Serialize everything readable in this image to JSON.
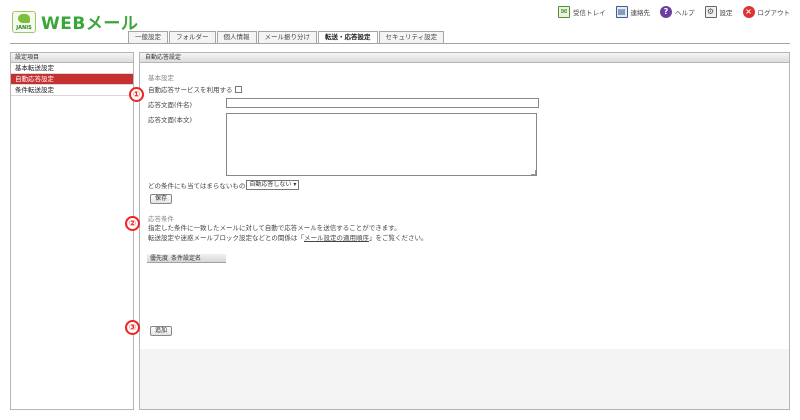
{
  "app": {
    "logo_badge_text": "JANIS",
    "title": "WEBメール"
  },
  "top_links": [
    {
      "label": "受信トレイ",
      "icon": "inbox-icon"
    },
    {
      "label": "連絡先",
      "icon": "address-book-icon"
    },
    {
      "label": "ヘルプ",
      "icon": "help-icon"
    },
    {
      "label": "設定",
      "icon": "settings-icon"
    },
    {
      "label": "ログアウト",
      "icon": "logout-icon"
    }
  ],
  "tabs": [
    {
      "label": "一般設定",
      "active": false
    },
    {
      "label": "フォルダー",
      "active": false
    },
    {
      "label": "個人情報",
      "active": false
    },
    {
      "label": "メール振り分け",
      "active": false
    },
    {
      "label": "転送・応答設定",
      "active": true
    },
    {
      "label": "セキュリティ設定",
      "active": false
    }
  ],
  "sidebar": {
    "header": "設定項目",
    "items": [
      {
        "label": "基本転送設定",
        "active": false
      },
      {
        "label": "自動応答設定",
        "active": true
      },
      {
        "label": "条件転送設定",
        "active": false
      }
    ]
  },
  "main": {
    "header": "自動応答設定",
    "basic": {
      "section_label": "基本設定",
      "enable_label": "自動応答サービスを利用する",
      "enable_checked": false,
      "subject_label": "応答文面(件名)",
      "subject_value": "",
      "body_label": "応答文面(本文)",
      "body_value": "",
      "fallback_label": "どの条件にも当てはまらないもの",
      "fallback_select": "自動応答しない",
      "save_label": "保存"
    },
    "conditions": {
      "section_label": "応答条件",
      "info_line1": "指定した条件に一致したメールに対して自動で応答メールを送信することができます。",
      "info_line2_prefix": "転送設定や迷惑メールブロック設定などとの関係は「",
      "info_link": "メール設定の適用順序",
      "info_line2_suffix": "」をご覧ください。",
      "col_priority": "優先度",
      "col_name": "条件設定名",
      "add_label": "追加"
    }
  },
  "markers": [
    "①",
    "②",
    "③"
  ]
}
